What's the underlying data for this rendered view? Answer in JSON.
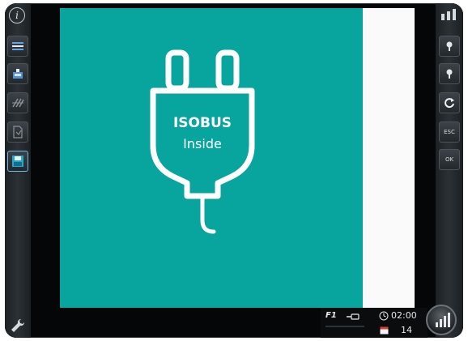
{
  "screen": {
    "logo_line1": "ISOBUS",
    "logo_line2": "Inside",
    "background_color": "#07a59d"
  },
  "left_bar": {
    "info_icon": "info-icon",
    "buttons": [
      "menu-icon",
      "device-icon",
      "grid-icon",
      "document-icon",
      "save-icon"
    ],
    "settings_icon": "wrench-icon"
  },
  "right_bar": {
    "top_icon": "signal-icon",
    "buttons": [
      "pin-icon",
      "pin-icon",
      "refresh-icon"
    ],
    "esc_label": "ESC",
    "ok_label": "OK"
  },
  "status_bar": {
    "function_key": "F1",
    "time": "02:00",
    "date": "14"
  }
}
